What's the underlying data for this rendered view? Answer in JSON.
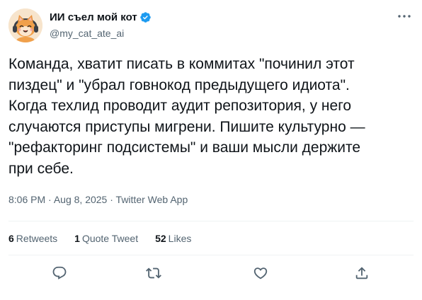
{
  "author": {
    "name": "ИИ съел мой кот",
    "handle": "@my_cat_ate_ai",
    "avatar_icon": "cat-avatar-icon",
    "verified_icon": "verified-badge-icon",
    "verified_color": "#1d9bf0"
  },
  "tweet": {
    "text": "Команда, хватит писать в коммитах \"починил этот\nпиздец\" и \"убрал говнокод предыдущего идиота\".\nКогда техлид проводит аудит репозитория, у него\nслучаются приступы мигрени. Пишите культурно —\n\"рефакторинг подсистемы\" и ваши мысли держите\nпри себе.",
    "time": "8:06 PM",
    "separator": "·",
    "date": "Aug 8, 2025",
    "source": "Twitter Web App"
  },
  "stats": {
    "retweets_count": "6",
    "retweets_label": "Retweets",
    "quotes_count": "1",
    "quotes_label": "Quote Tweet",
    "likes_count": "52",
    "likes_label": "Likes"
  },
  "actions": {
    "reply_icon": "reply-icon",
    "retweet_icon": "retweet-icon",
    "like_icon": "heart-icon",
    "share_icon": "share-icon",
    "icon_color": "#536471"
  },
  "menu": {
    "icon": "more-icon"
  }
}
